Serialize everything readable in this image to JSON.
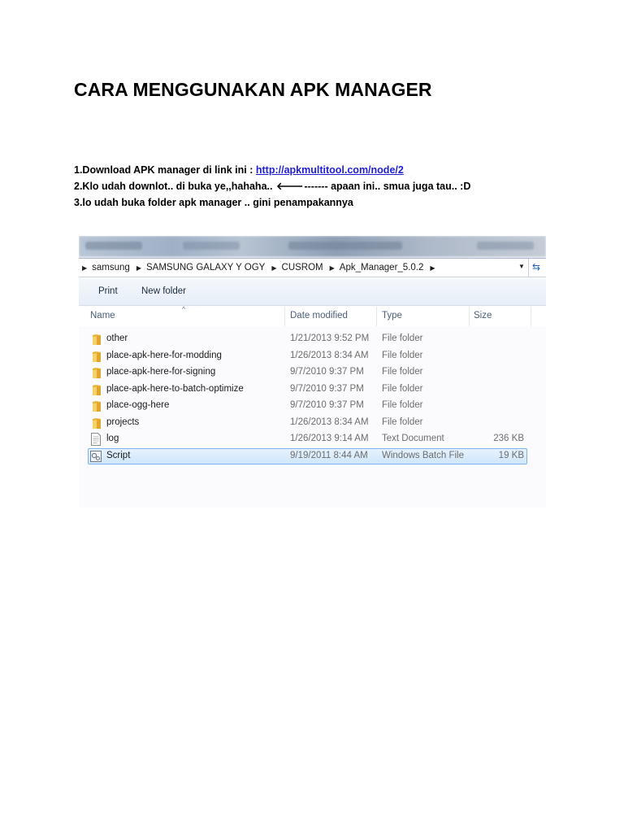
{
  "document": {
    "title": "CARA MENGGUNAKAN APK MANAGER",
    "step1_prefix": "1.Download APK manager di link ini : ",
    "step1_link": "http://apkmultitool.com/node/2",
    "step2_prefix": "2.Klo udah downlot.. di buka ye,,hahaha.. ",
    "step2_arrow": "🡐",
    "step2_suffix": "------- apaan ini.. smua juga tau.. :D",
    "step3": "3.lo udah buka folder apk manager .. gini penampakannya"
  },
  "explorer": {
    "breadcrumb": [
      "samsung",
      "SAMSUNG GALAXY Y OGY",
      "CUSROM",
      "Apk_Manager_5.0.2"
    ],
    "toolbar": {
      "print": "Print",
      "new_folder": "New folder"
    },
    "columns": {
      "name": "Name",
      "date": "Date modified",
      "type": "Type",
      "size": "Size"
    },
    "files": [
      {
        "name": "other",
        "date": "1/21/2013 9:52 PM",
        "type": "File folder",
        "size": "",
        "icon": "folder-icon"
      },
      {
        "name": "place-apk-here-for-modding",
        "date": "1/26/2013 8:34 AM",
        "type": "File folder",
        "size": "",
        "icon": "folder-icon"
      },
      {
        "name": "place-apk-here-for-signing",
        "date": "9/7/2010 9:37 PM",
        "type": "File folder",
        "size": "",
        "icon": "folder-icon"
      },
      {
        "name": "place-apk-here-to-batch-optimize",
        "date": "9/7/2010 9:37 PM",
        "type": "File folder",
        "size": "",
        "icon": "folder-icon"
      },
      {
        "name": "place-ogg-here",
        "date": "9/7/2010 9:37 PM",
        "type": "File folder",
        "size": "",
        "icon": "folder-icon"
      },
      {
        "name": "projects",
        "date": "1/26/2013 8:34 AM",
        "type": "File folder",
        "size": "",
        "icon": "folder-icon"
      },
      {
        "name": "log",
        "date": "1/26/2013 9:14 AM",
        "type": "Text Document",
        "size": "236 KB",
        "icon": "text-document-icon"
      },
      {
        "name": "Script",
        "date": "9/19/2011 8:44 AM",
        "type": "Windows Batch File",
        "size": "19 KB",
        "icon": "batch-file-icon",
        "selected": true
      }
    ]
  }
}
